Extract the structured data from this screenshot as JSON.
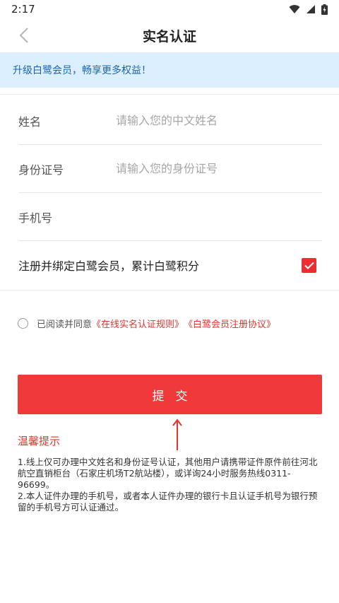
{
  "status_bar": {
    "time": "2:17"
  },
  "header": {
    "title": "实名认证"
  },
  "promo": {
    "text": "升级白鹭会员，畅享更多权益！"
  },
  "form": {
    "name": {
      "label": "姓名",
      "placeholder": "请输入您的中文姓名",
      "value": ""
    },
    "id_number": {
      "label": "身份证号",
      "placeholder": "请输入您的身份证号",
      "value": ""
    },
    "phone": {
      "label": "手机号",
      "placeholder": "",
      "value": ""
    },
    "bind_member": {
      "label": "注册并绑定白鹭会员，累计白鹭积分",
      "checked": true
    }
  },
  "agreement": {
    "prefix": "已阅读并同意",
    "rule_link": "《在线实名认证规则》",
    "protocol_link": "《白鹭会员注册协议》",
    "checked": false
  },
  "submit": {
    "label": "提交"
  },
  "tips": {
    "title": "温馨提示",
    "items": [
      "1.线上仅可办理中文姓名和身份证号认证，其他用户请携带证件原件前往河北航空直销柜台（石家庄机场T2航站楼），或详询24小时服务热线0311-96699。",
      "2.本人证件办理的手机号，或者本人证件办理的银行卡且认证手机号为银行预留的手机号方可认证通过。"
    ]
  },
  "colors": {
    "accent": "#f0393a",
    "link": "#e2342f",
    "promo_bg": "#dcefff",
    "promo_text": "#1b64b5"
  },
  "icons": [
    "back-chevron-icon",
    "wifi-icon",
    "signal-icon",
    "battery-icon",
    "checkmark-icon",
    "up-arrow-icon"
  ]
}
